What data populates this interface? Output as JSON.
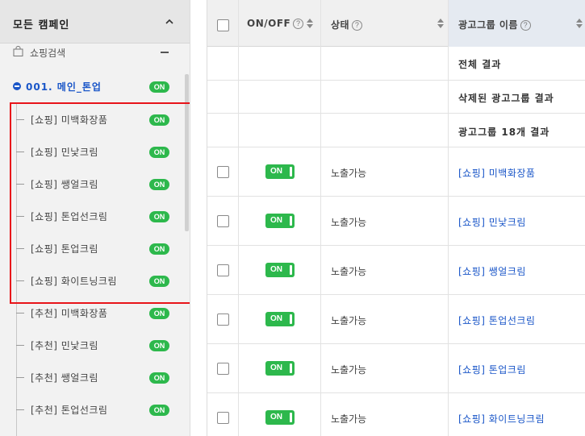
{
  "sidebar": {
    "title": "모든 캠페인",
    "shopping_label": "쇼핑검색",
    "campaign": {
      "label": "001. 메인_톤업",
      "badge": "ON"
    },
    "items": [
      {
        "label": "[쇼핑] 미백화장품",
        "badge": "ON"
      },
      {
        "label": "[쇼핑] 민낯크림",
        "badge": "ON"
      },
      {
        "label": "[쇼핑] 쌩얼크림",
        "badge": "ON"
      },
      {
        "label": "[쇼핑] 톤업선크림",
        "badge": "ON"
      },
      {
        "label": "[쇼핑] 톤업크림",
        "badge": "ON"
      },
      {
        "label": "[쇼핑] 화이트닝크림",
        "badge": "ON"
      },
      {
        "label": "[추천] 미백화장품",
        "badge": "ON"
      },
      {
        "label": "[추천] 민낯크림",
        "badge": "ON"
      },
      {
        "label": "[추천] 쌩얼크림",
        "badge": "ON"
      },
      {
        "label": "[추천] 톤업선크림",
        "badge": "ON"
      }
    ]
  },
  "table": {
    "headers": {
      "onoff": "ON/OFF",
      "status": "상태",
      "name": "광고그룹 이름",
      "help": "?"
    },
    "summary": [
      "전체 결과",
      "삭제된 광고그룹 결과",
      "광고그룹 18개 결과"
    ],
    "rows": [
      {
        "toggle": "ON",
        "status": "노출가능",
        "name": "[쇼핑] 미백화장품"
      },
      {
        "toggle": "ON",
        "status": "노출가능",
        "name": "[쇼핑] 민낯크림"
      },
      {
        "toggle": "ON",
        "status": "노출가능",
        "name": "[쇼핑] 쌩얼크림"
      },
      {
        "toggle": "ON",
        "status": "노출가능",
        "name": "[쇼핑] 톤업선크림"
      },
      {
        "toggle": "ON",
        "status": "노출가능",
        "name": "[쇼핑] 톤업크림"
      },
      {
        "toggle": "ON",
        "status": "노출가능",
        "name": "[쇼핑] 화이트닝크림"
      }
    ]
  },
  "colors": {
    "accent_blue": "#1a56c8",
    "on_green": "#2db84c",
    "highlight_red": "#e8141a"
  }
}
